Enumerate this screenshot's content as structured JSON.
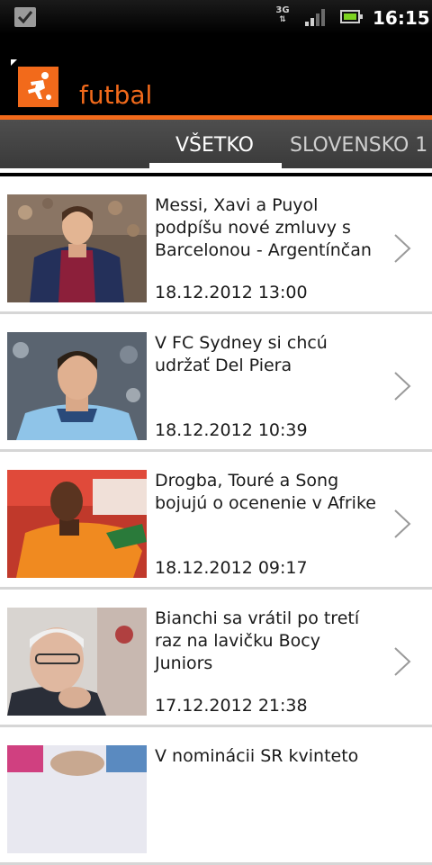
{
  "status_bar": {
    "network": "3G",
    "time": "16:15",
    "icons": [
      "checkbox-icon",
      "signal-icon",
      "battery-icon"
    ]
  },
  "app": {
    "title": "futbal",
    "logo_icon": "soccer-player-icon",
    "accent_color": "#f26a1b"
  },
  "tabs": [
    {
      "label": "VŠETKO",
      "active": true
    },
    {
      "label": "SLOVENSKO 1",
      "active": false
    }
  ],
  "articles": [
    {
      "title": "Messi, Xavi a Puyol podpíšu nové zmluvy s Barcelonou - Argentínčan",
      "date": "18.12.2012 13:00"
    },
    {
      "title": "V FC Sydney si chcú udržať Del Piera",
      "date": "18.12.2012 10:39"
    },
    {
      "title": "Drogba, Touré a Song bojujú o ocenenie v Afrike",
      "date": "18.12.2012 09:17"
    },
    {
      "title": "Bianchi sa vrátil po tretí raz na lavičku Bocy Juniors",
      "date": "17.12.2012 21:38"
    },
    {
      "title": "V nominácii SR kvinteto",
      "date": ""
    }
  ]
}
